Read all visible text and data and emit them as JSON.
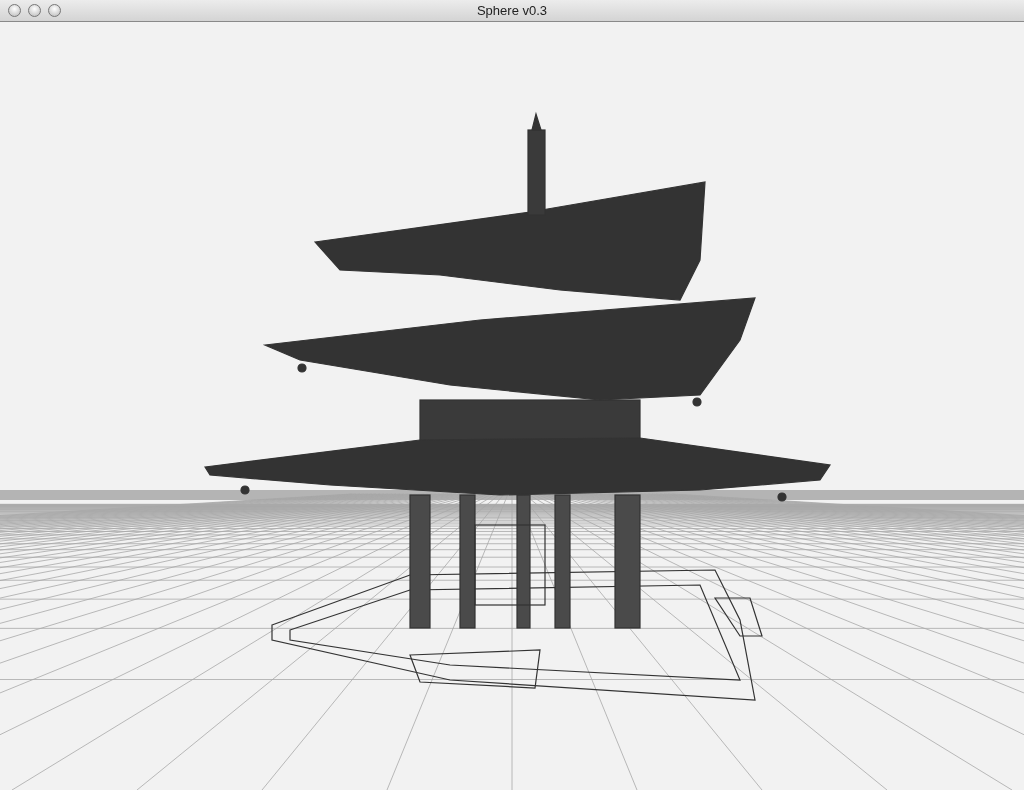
{
  "window": {
    "title": "Sphere v0.3"
  }
}
